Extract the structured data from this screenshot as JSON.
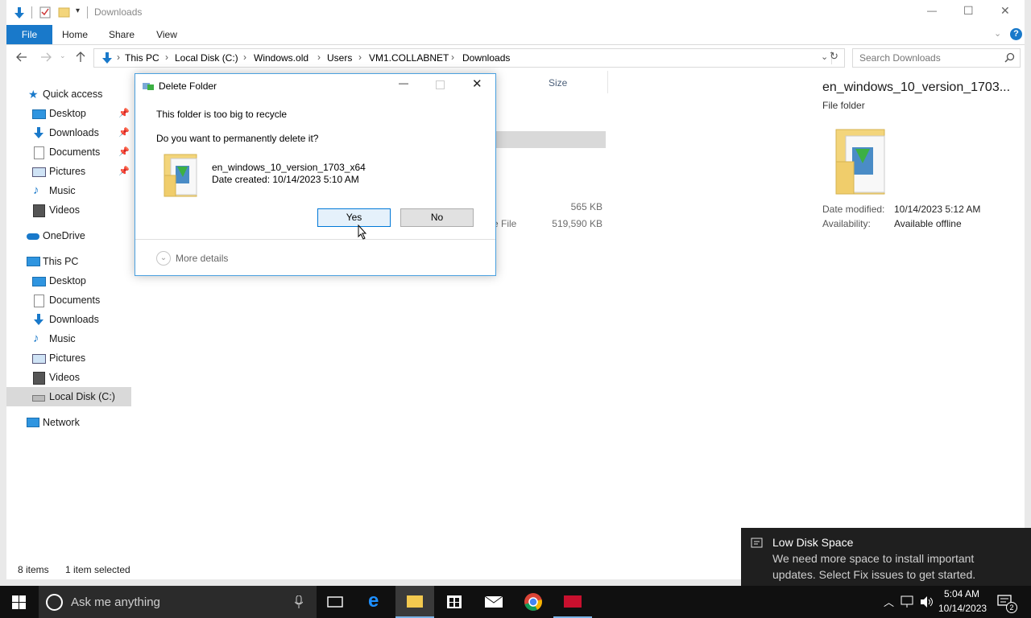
{
  "window": {
    "title": "Downloads",
    "qat_dropdown": "▾",
    "controls": {
      "minimize": "—",
      "maximize": "☐",
      "close": "✕"
    }
  },
  "ribbon": {
    "tabs": [
      "File",
      "Home",
      "Share",
      "View"
    ],
    "help": "?"
  },
  "address": {
    "crumbs": [
      "This PC",
      "Local Disk (C:)",
      "Windows.old",
      "Users",
      "VM1.COLLABNET",
      "Downloads"
    ],
    "separator": "›",
    "search_placeholder": "Search Downloads"
  },
  "sidebar": {
    "quick_access": "Quick access",
    "quick_items": [
      {
        "label": "Desktop",
        "pinned": true
      },
      {
        "label": "Downloads",
        "pinned": true
      },
      {
        "label": "Documents",
        "pinned": true
      },
      {
        "label": "Pictures",
        "pinned": true
      },
      {
        "label": "Music",
        "pinned": false
      },
      {
        "label": "Videos",
        "pinned": false
      }
    ],
    "onedrive": "OneDrive",
    "this_pc": "This PC",
    "pc_items": [
      "Desktop",
      "Documents",
      "Downloads",
      "Music",
      "Pictures",
      "Videos",
      "Local Disk (C:)"
    ],
    "network": "Network"
  },
  "content": {
    "col_size": "Size",
    "rows": [
      {
        "type_fragment": "",
        "size": "565 KB"
      },
      {
        "type_fragment": "e File",
        "size": "519,590 KB"
      }
    ]
  },
  "preview": {
    "name": "en_windows_10_version_1703...",
    "kind": "File folder",
    "date_modified_label": "Date modified:",
    "date_modified": "10/14/2023 5:12 AM",
    "availability_label": "Availability:",
    "availability": "Available offline"
  },
  "status": {
    "items": "8 items",
    "selected": "1 item selected"
  },
  "dialog": {
    "title": "Delete Folder",
    "line1": "This folder is too big to recycle",
    "line2": "Do you want to permanently delete it?",
    "file_name": "en_windows_10_version_1703_x64",
    "date_created": "Date created: 10/14/2023 5:10 AM",
    "yes": "Yes",
    "no": "No",
    "more_details": "More details"
  },
  "toast": {
    "title": "Low Disk Space",
    "line1": "We need more space to install important",
    "line2": "updates. Select Fix issues to get started."
  },
  "taskbar": {
    "search_placeholder": "Ask me anything",
    "time": "5:04 AM",
    "date": "10/14/2023",
    "notif_count": "2"
  },
  "colors": {
    "accent": "#1979ca",
    "folder": "#f3d57b",
    "dialog_border": "#4aa0df",
    "yes_bg": "#e5f1fb",
    "taskbar": "#101010"
  }
}
